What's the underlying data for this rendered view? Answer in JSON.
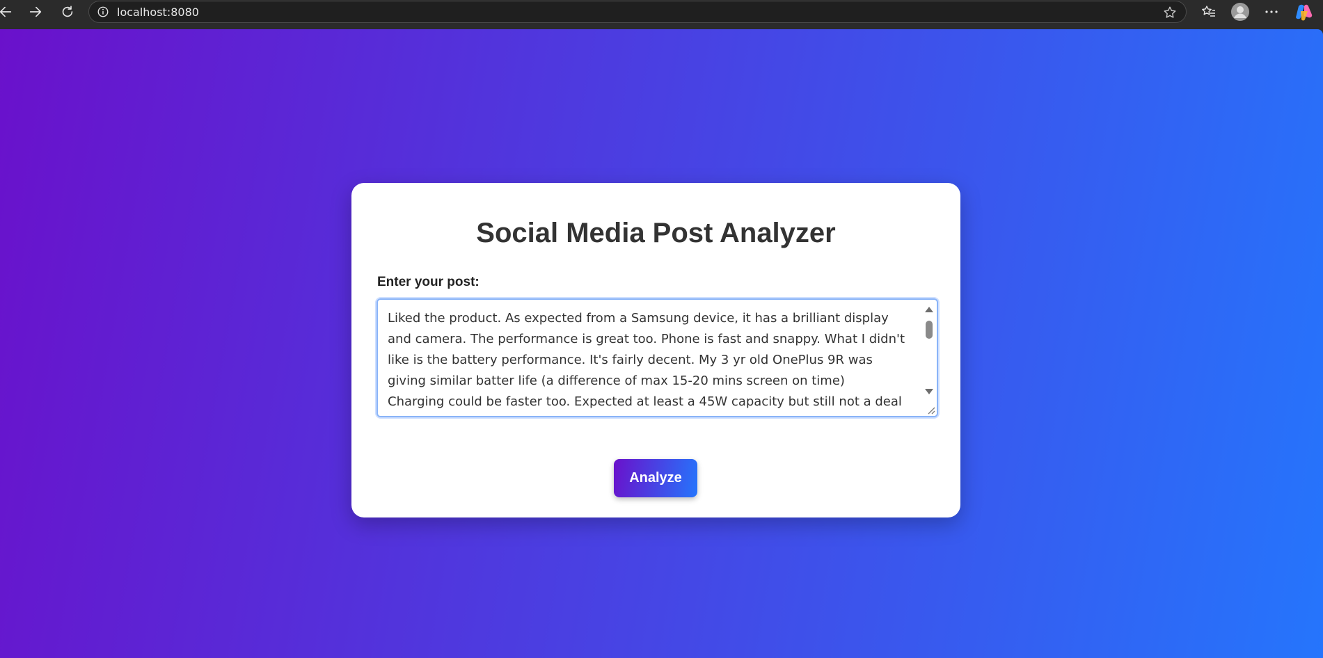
{
  "browser": {
    "url": "localhost:8080",
    "icons": {
      "back": "back-arrow-icon",
      "forward": "forward-arrow-icon",
      "reload": "reload-icon",
      "site_info": "info-icon",
      "favorite": "star-icon",
      "favorites_list": "favorites-icon",
      "profile": "profile-avatar-icon",
      "menu": "more-options-icon",
      "copilot": "copilot-icon"
    }
  },
  "page": {
    "background_gradient": [
      "#6a11cb",
      "#2575fc"
    ],
    "card": {
      "title": "Social Media Post Analyzer",
      "label": "Enter your post:",
      "post_text": "Liked the product. As expected from a Samsung device, it has a brilliant display and camera. The performance is great too. Phone is fast and snappy. What I didn't like is the battery performance. It's fairly decent. My 3 yr old OnePlus 9R was giving similar batter life (a difference of max 15-20 mins screen on time)\nCharging could be faster too. Expected at least a 45W capacity but still not a deal",
      "button_label": "Analyze"
    }
  }
}
